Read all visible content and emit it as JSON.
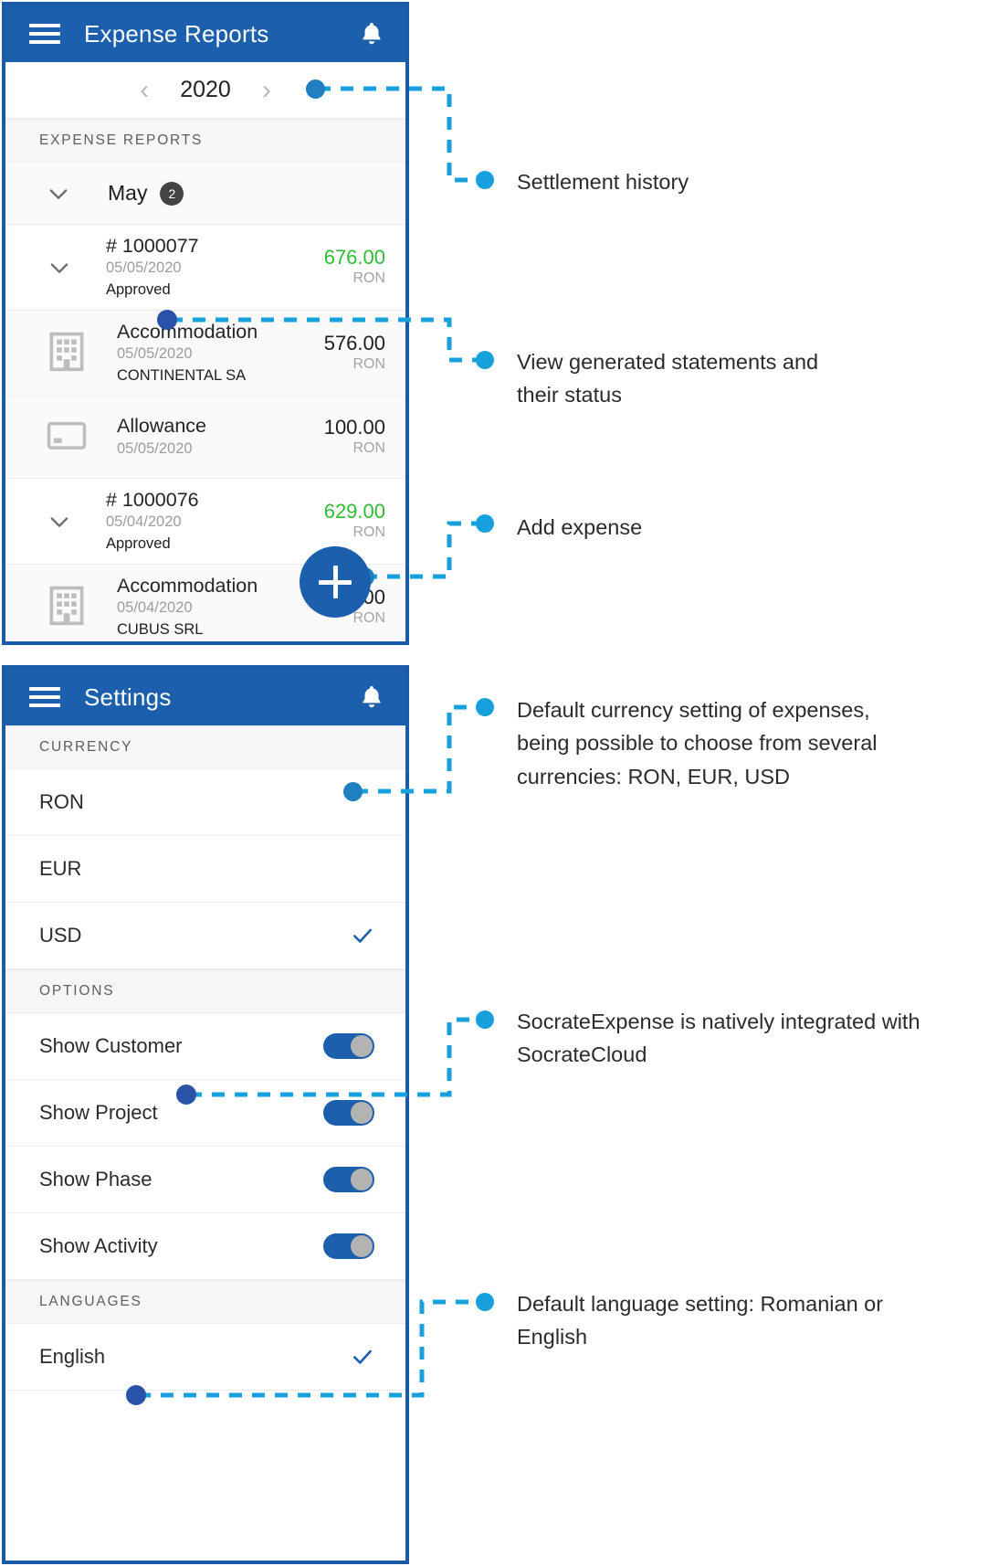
{
  "colors": {
    "brand_blue": "#1b5fad",
    "annotation_blue": "#17a0db",
    "navy_dot": "#2853a8",
    "amount_green": "#2fbc35",
    "frame_border": "#1c5aa8"
  },
  "screen_reports": {
    "appbar": {
      "title": "Expense Reports",
      "menu_icon": "hamburger-icon",
      "notification_icon": "bell-icon"
    },
    "year_selector": {
      "prev_icon": "chevron-left-icon",
      "year": "2020",
      "next_icon": "chevron-right-icon"
    },
    "section_header": "EXPENSE REPORTS",
    "month_group": {
      "name": "May",
      "count": "2",
      "caret_icon": "chevron-down-icon"
    },
    "rows": [
      {
        "kind": "report",
        "icon": "chevron-down-icon",
        "title": "# 1000077",
        "date": "05/05/2020",
        "sub": "Approved",
        "amount": "676.00",
        "currency": "RON",
        "amount_color": "green"
      },
      {
        "kind": "expense",
        "icon": "building-icon",
        "title": "Accommodation",
        "date": "05/05/2020",
        "sub": "CONTINENTAL SA",
        "amount": "576.00",
        "currency": "RON",
        "amount_color": "dark"
      },
      {
        "kind": "expense",
        "icon": "card-icon",
        "title": "Allowance",
        "date": "05/05/2020",
        "sub": "",
        "amount": "100.00",
        "currency": "RON",
        "amount_color": "dark"
      },
      {
        "kind": "report",
        "icon": "chevron-down-icon",
        "title": "# 1000076",
        "date": "05/04/2020",
        "sub": "Approved",
        "amount": "629.00",
        "currency": "RON",
        "amount_color": "green"
      },
      {
        "kind": "expense",
        "icon": "building-icon",
        "title": "Accommodation",
        "date": "05/04/2020",
        "sub": "CUBUS SRL",
        "amount": "345.00",
        "currency": "RON",
        "amount_color": "dark"
      }
    ],
    "fab": {
      "icon": "plus-icon",
      "label": ""
    }
  },
  "screen_settings": {
    "appbar": {
      "title": "Settings",
      "menu_icon": "hamburger-icon",
      "notification_icon": "bell-icon"
    },
    "currency_section": {
      "header": "CURRENCY",
      "options": [
        {
          "label": "RON",
          "selected": false
        },
        {
          "label": "EUR",
          "selected": false
        },
        {
          "label": "USD",
          "selected": true
        }
      ]
    },
    "options_section": {
      "header": "OPTIONS",
      "toggles": [
        {
          "label": "Show Customer",
          "on": true
        },
        {
          "label": "Show Project",
          "on": true
        },
        {
          "label": "Show Phase",
          "on": true
        },
        {
          "label": "Show Activity",
          "on": true
        }
      ]
    },
    "languages_section": {
      "header": "LANGUAGES",
      "options": [
        {
          "label": "English",
          "selected": true
        }
      ]
    }
  },
  "annotations": [
    {
      "id": "settlement-history",
      "line1": "Settlement history",
      "line2": ""
    },
    {
      "id": "view-statements",
      "line1": "View generated statements and",
      "line2": "their status"
    },
    {
      "id": "add-expense",
      "line1": "Add expense",
      "line2": ""
    },
    {
      "id": "default-currency",
      "line1": "Default currency setting of expenses,",
      "line2": "being possible to choose from several",
      "line3": "currencies: RON, EUR, USD"
    },
    {
      "id": "native-integration",
      "line1": "SocrateExpense is natively integrated with",
      "line2": "SocrateCloud"
    },
    {
      "id": "default-language",
      "line1": "Default language setting: Romanian or",
      "line2": "English"
    }
  ]
}
